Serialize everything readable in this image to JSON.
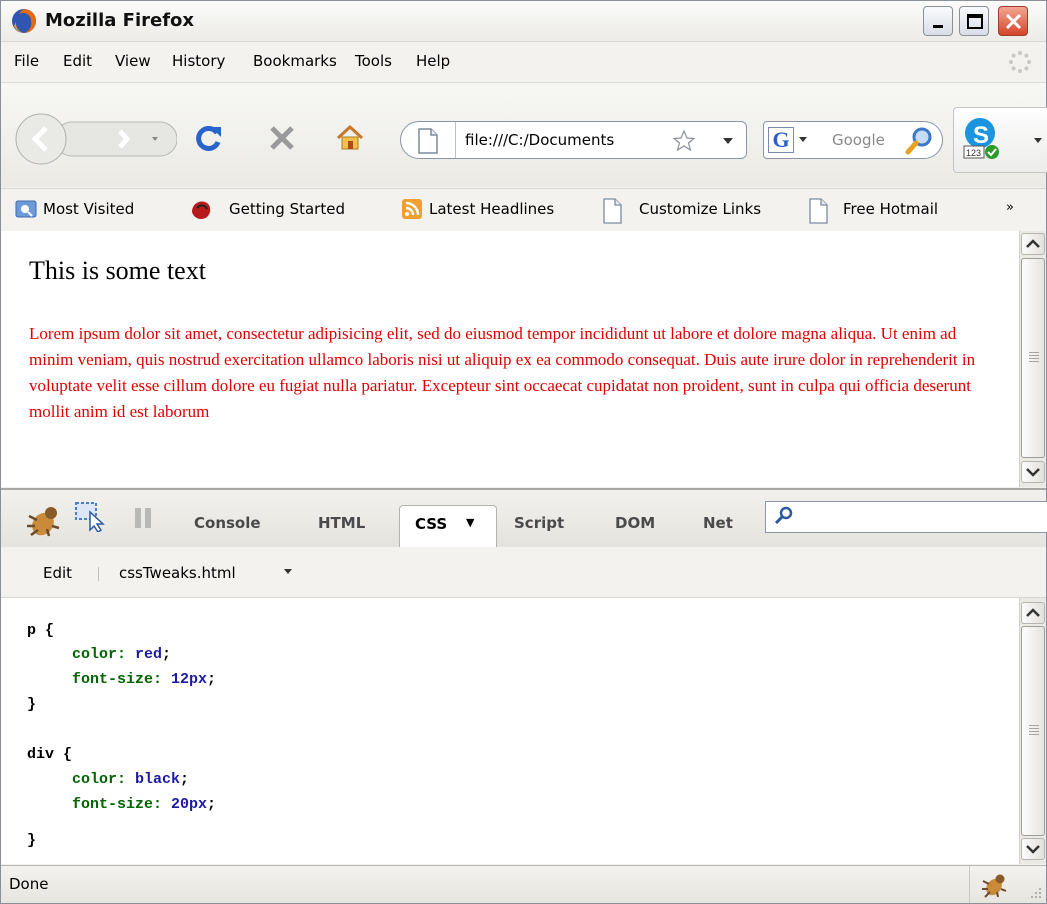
{
  "window": {
    "title": "Mozilla Firefox",
    "controls": {
      "minimize": "minimize-icon",
      "maximize": "maximize-icon",
      "close": "close-icon"
    }
  },
  "menubar": {
    "items": [
      "File",
      "Edit",
      "View",
      "History",
      "Bookmarks",
      "Tools",
      "Help"
    ]
  },
  "navbar": {
    "url": "file:///C:/Documents",
    "search_placeholder": "Google",
    "search_engine_icon": "G"
  },
  "bookmarks": {
    "items": [
      {
        "label": "Most Visited",
        "icon": "most-visited-icon"
      },
      {
        "label": "Getting Started",
        "icon": "firefox-red-icon"
      },
      {
        "label": "Latest Headlines",
        "icon": "rss-icon"
      },
      {
        "label": "Customize Links",
        "icon": "page-icon"
      },
      {
        "label": "Free Hotmail",
        "icon": "page-icon"
      }
    ],
    "overflow": "»"
  },
  "page": {
    "heading": "This is some text",
    "paragraph": "Lorem ipsum dolor sit amet, consectetur adipisicing elit, sed do eiusmod tempor incididunt ut labore et dolore magna aliqua. Ut enim ad minim veniam, quis nostrud exercitation ullamco laboris nisi ut aliquip ex ea commodo consequat. Duis aute irure dolor in reprehenderit in voluptate velit esse cillum dolore eu fugiat nulla pariatur. Excepteur sint occaecat cupidatat non proident, sunt in culpa qui officia deserunt mollit anim id est laborum",
    "heading_color": "#000000",
    "paragraph_color": "#e00000"
  },
  "firebug": {
    "tabs": [
      "Console",
      "HTML",
      "CSS",
      "Script",
      "DOM",
      "Net"
    ],
    "active_tab": "CSS",
    "active_caret": "▼",
    "sub_edit": "Edit",
    "sub_file": "cssTweaks.html",
    "code": {
      "rule1_selector": "p",
      "rule1_open": "{",
      "rule1_prop1": "color:",
      "rule1_val1": "red",
      "rule1_prop2": "font-size:",
      "rule1_val2": "12px",
      "rule1_close": "}",
      "rule2_selector": "div",
      "rule2_open": "{",
      "rule2_prop1": "color:",
      "rule2_val1": "black",
      "rule2_prop2": "font-size:",
      "rule2_val2": "20px",
      "rule2_close": "}",
      "semicolon": ";"
    }
  },
  "status": {
    "text": "Done"
  }
}
